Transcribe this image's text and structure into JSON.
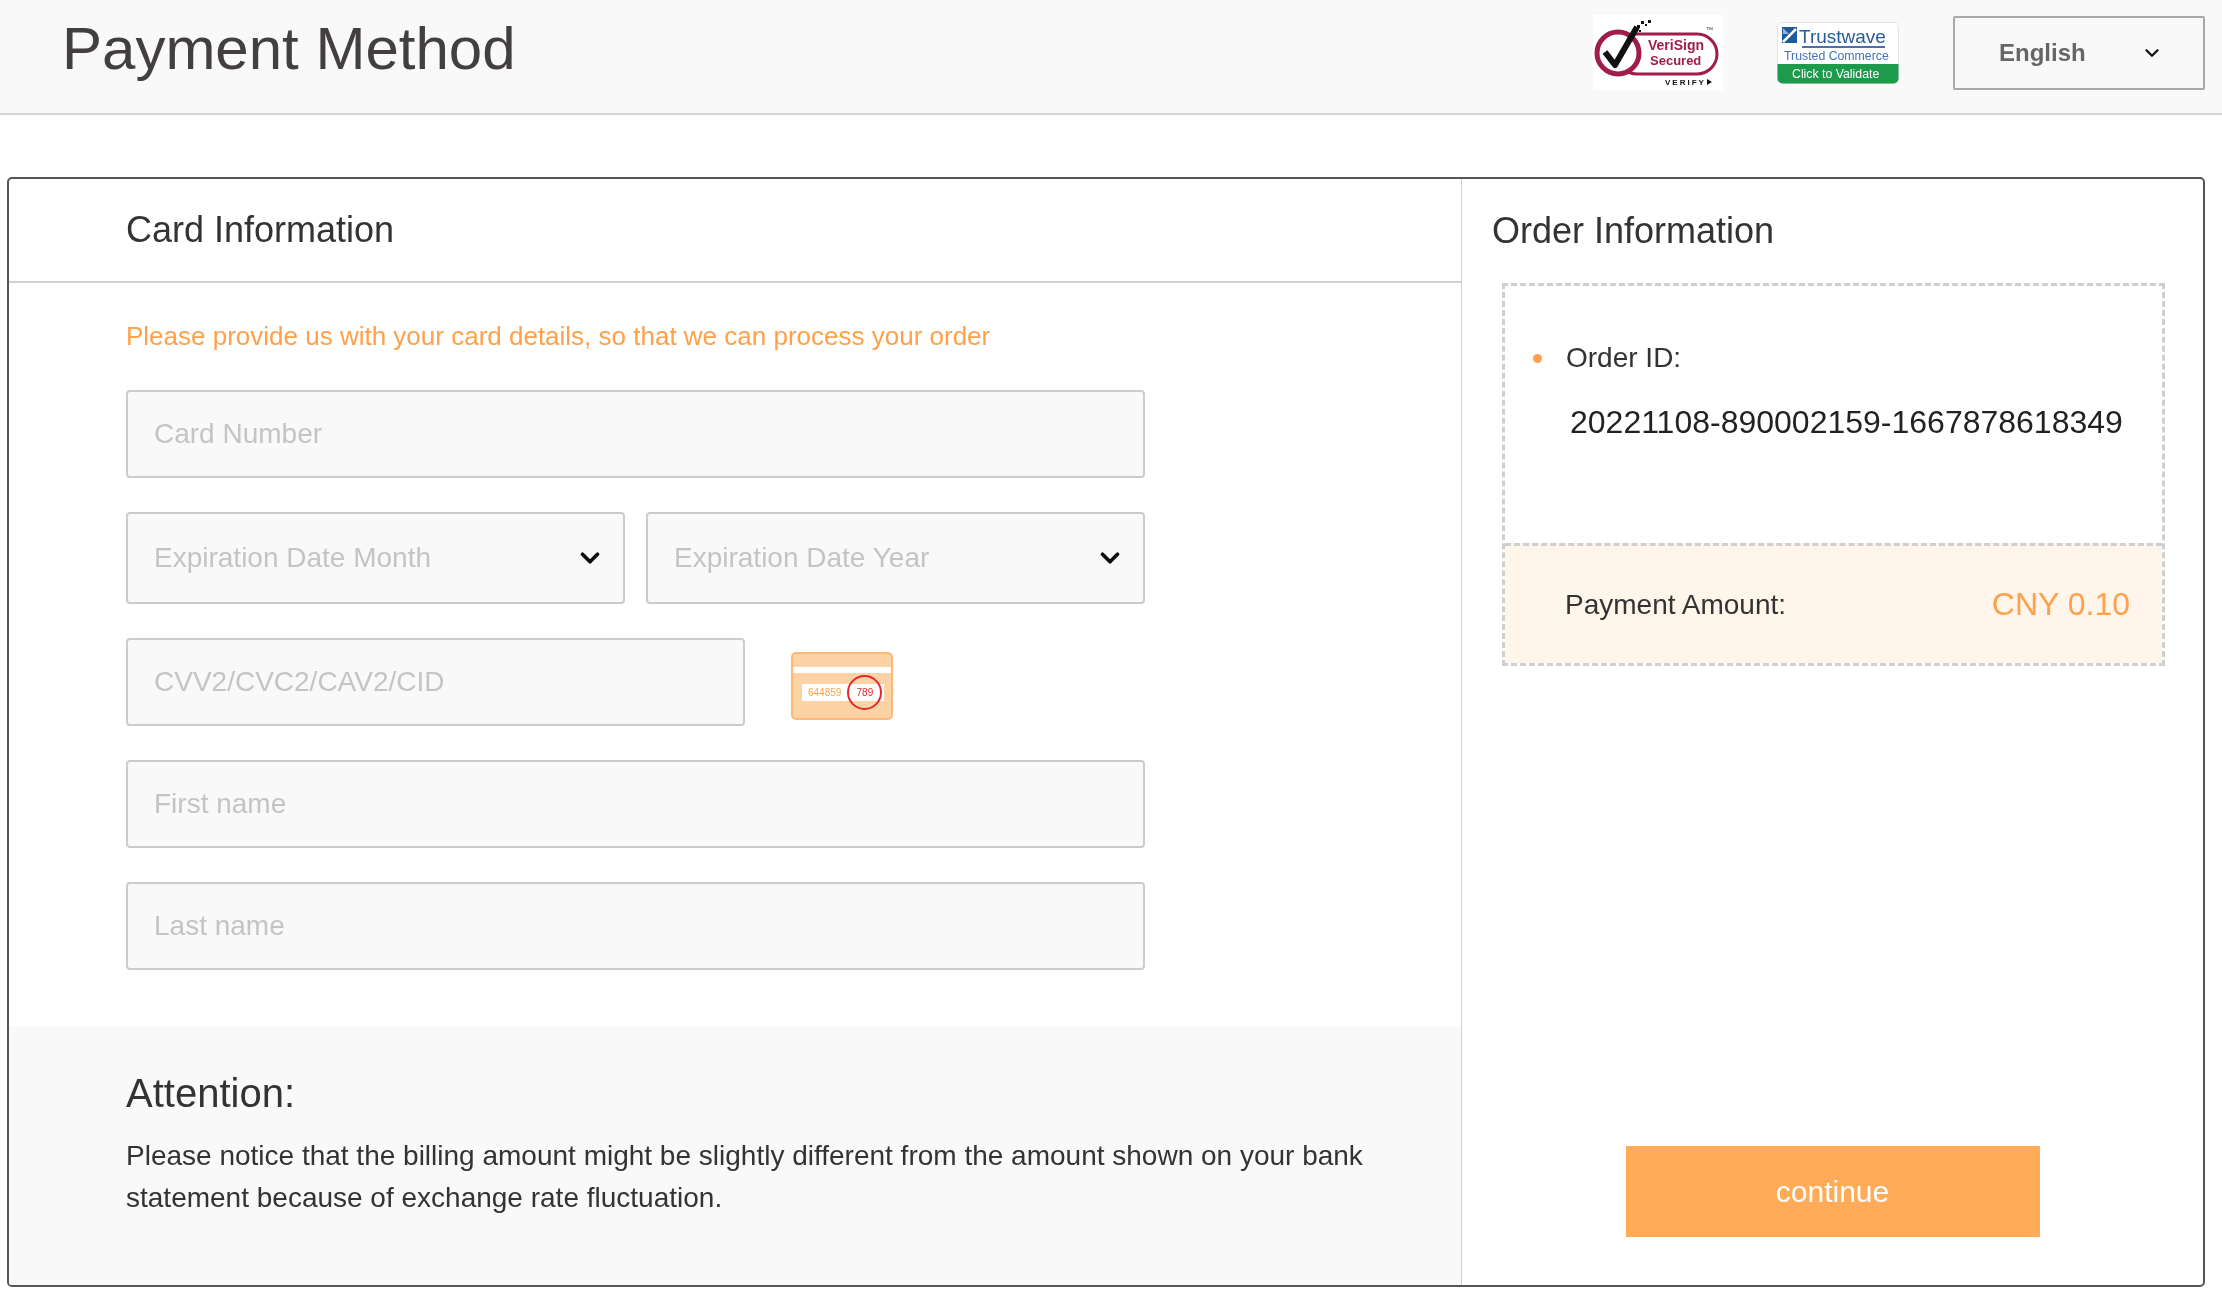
{
  "header": {
    "title": "Payment Method",
    "badges": [
      {
        "kind": "verisign",
        "name_line": "VeriSign",
        "sub_line": "Secured",
        "link": "VERIFY",
        "mark": "™"
      },
      {
        "kind": "trustwave",
        "name_line": "Trustwave",
        "sub_line": "Trusted Commerce",
        "link": "Click to Validate"
      }
    ],
    "language": {
      "value": "English"
    }
  },
  "card_information": {
    "title": "Card Information",
    "hint": "Please provide us with your card details, so that we can process your order",
    "card_number": {
      "placeholder": "Card Number"
    },
    "expiration_month": {
      "placeholder": "Expiration Date Month"
    },
    "expiration_year": {
      "placeholder": "Expiration Date Year"
    },
    "cvv": {
      "placeholder": "CVV2/CVC2/CAV2/CID",
      "sample_number": "644859",
      "sample_code": "789"
    },
    "first_name": {
      "placeholder": "First name"
    },
    "last_name": {
      "placeholder": "Last name"
    }
  },
  "attention": {
    "title": "Attention:",
    "text": "Please notice that the billing amount might be slightly different from the amount shown on your bank statement because of exchange rate fluctuation."
  },
  "order_information": {
    "title": "Order Information",
    "order_id_label": "Order ID:",
    "order_id": "20221108-890002159-1667878618349",
    "amount_label": "Payment Amount:",
    "amount": "CNY 0.10"
  },
  "continue_button": {
    "label": "continue"
  }
}
